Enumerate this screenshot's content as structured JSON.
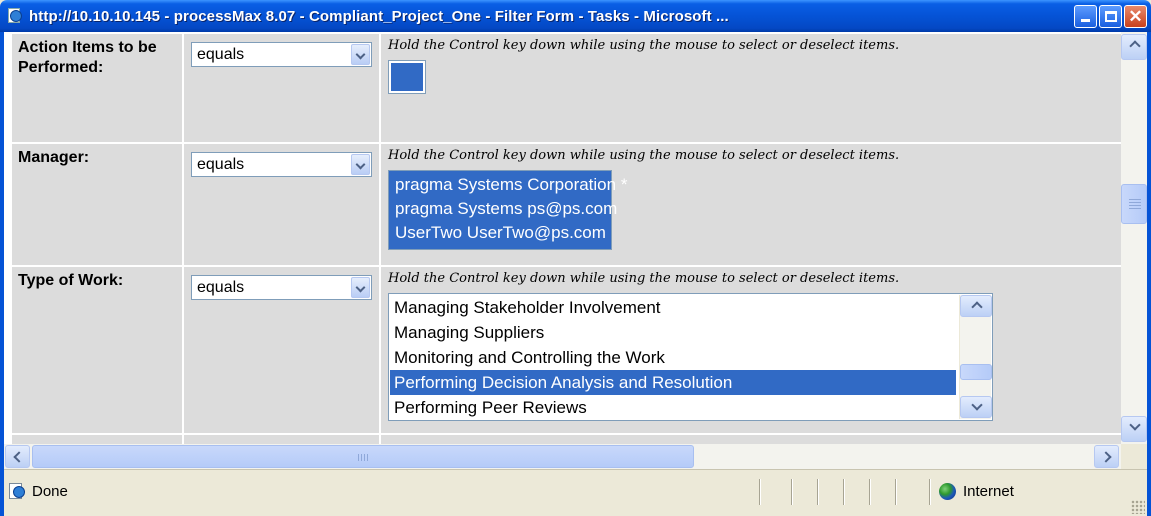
{
  "window": {
    "title": "http://10.10.10.145 - processMax 8.07 - Compliant_Project_One - Filter Form - Tasks - Microsoft ...",
    "controls": {
      "minimize": "minimize",
      "maximize": "maximize",
      "close": "✕"
    }
  },
  "hint_text": "Hold the Control key down while using the mouse to select or deselect items.",
  "rows": [
    {
      "label": "Action Items to be Performed:",
      "operator": "equals",
      "list_items": []
    },
    {
      "label": "Manager:",
      "operator": "equals",
      "list_items": [
        {
          "text": "pragma Systems Corporation *",
          "selected": true
        },
        {
          "text": "pragma Systems ps@ps.com",
          "selected": true
        },
        {
          "text": "UserTwo UserTwo@ps.com",
          "selected": true
        }
      ]
    },
    {
      "label": "Type of Work:",
      "operator": "equals",
      "list_items": [
        {
          "text": "Managing Stakeholder Involvement",
          "selected": false
        },
        {
          "text": "Managing Suppliers",
          "selected": false
        },
        {
          "text": "Monitoring and Controlling the Work",
          "selected": false
        },
        {
          "text": "Performing Decision Analysis and Resolution",
          "selected": true
        },
        {
          "text": "Performing Peer Reviews",
          "selected": false
        }
      ]
    }
  ],
  "statusbar": {
    "status": "Done",
    "zone": "Internet"
  },
  "colors": {
    "titlebar": "#0553d6",
    "selection": "#316ac5",
    "cell_background": "#dcdcdc"
  },
  "icons": {
    "title": "ie-page-icon",
    "zone": "internet-globe-icon"
  }
}
